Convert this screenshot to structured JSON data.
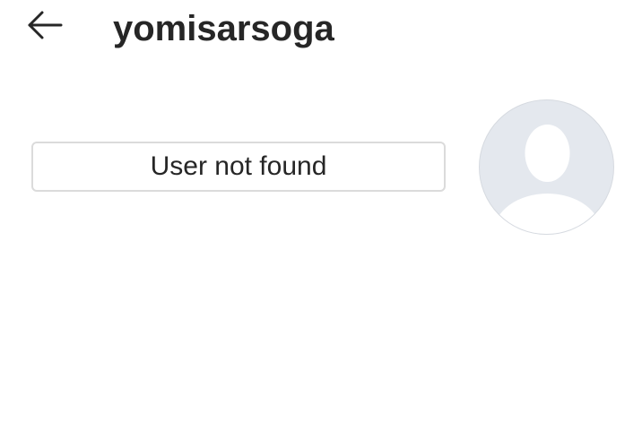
{
  "header": {
    "back_icon": "arrow-left-icon",
    "username": "yomisarsoga"
  },
  "profile": {
    "status_label": "User not found",
    "avatar_icon": "default-avatar-silhouette",
    "colors": {
      "avatar_background": "#e4e8ee",
      "avatar_silhouette": "#ffffff",
      "button_border": "#dbdbdb",
      "text": "#262626"
    }
  }
}
